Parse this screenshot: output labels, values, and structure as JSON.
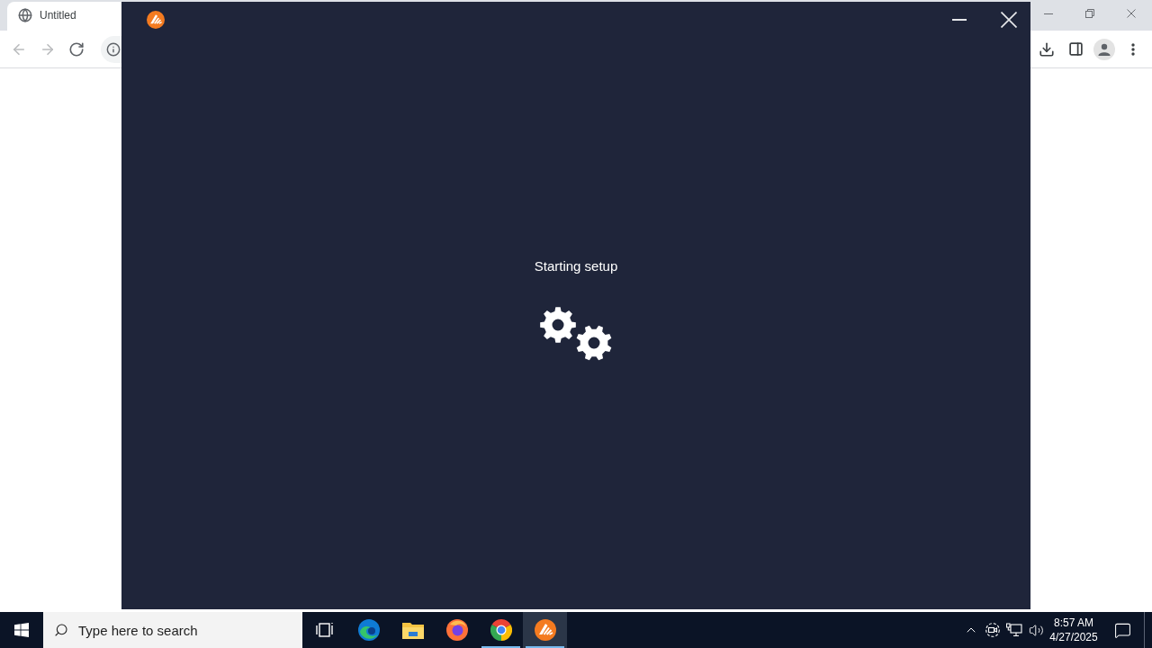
{
  "browser": {
    "tabs": [
      {
        "title": "Untitled",
        "selected": true
      }
    ],
    "toolbar": {
      "buttons": [
        {
          "kind": "back",
          "disabled": true
        },
        {
          "kind": "forward",
          "disabled": true
        },
        {
          "kind": "reload",
          "disabled": false
        }
      ]
    }
  },
  "installer": {
    "status": "Starting setup"
  },
  "taskbar": {
    "search": {
      "placeholder": "Type here to search"
    },
    "apps": [
      {
        "kind": "task-view",
        "running": false,
        "selected": false
      },
      {
        "kind": "edge",
        "running": false,
        "selected": false
      },
      {
        "kind": "explorer",
        "running": false,
        "selected": false
      },
      {
        "kind": "firefox",
        "running": false,
        "selected": false
      },
      {
        "kind": "chrome",
        "running": true,
        "selected": false
      },
      {
        "kind": "installer",
        "running": true,
        "selected": true
      }
    ],
    "clock": {
      "time": "8:57 AM",
      "date": "4/27/2025"
    }
  }
}
